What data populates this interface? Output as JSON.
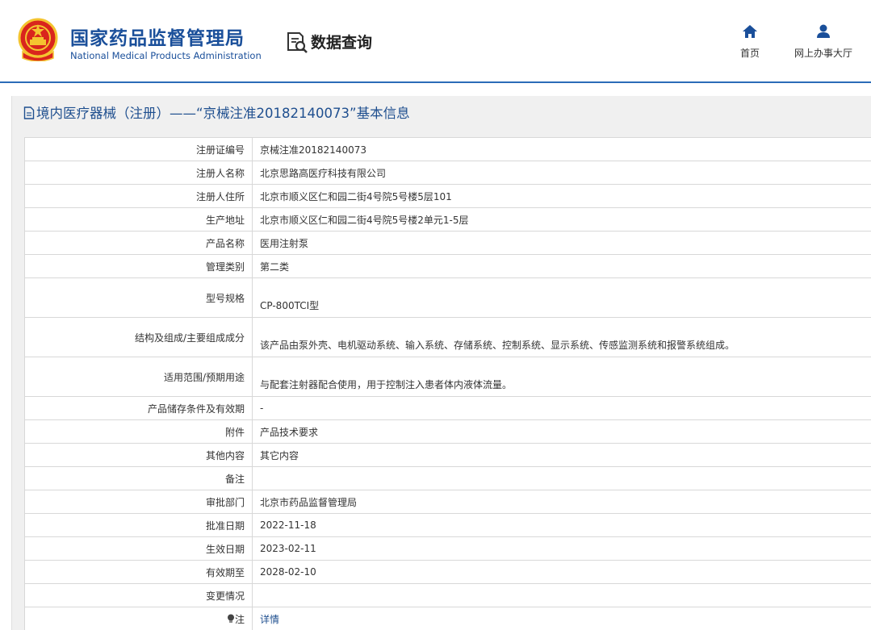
{
  "header": {
    "brand_cn": "国家药品监督管理局",
    "brand_en": "National Medical Products Administration",
    "data_query": "数据查询",
    "nav": {
      "home": "首页",
      "hall": "网上办事大厅"
    },
    "colors": {
      "brand": "#1a4f9a",
      "accent": "#2b6cb8",
      "emblem_red": "#d9251d",
      "emblem_gold": "#f4c430"
    }
  },
  "panel": {
    "title": "境内医疗器械（注册）——“京械注准20182140073”基本信息",
    "title_icon": "document-icon"
  },
  "rows": [
    {
      "label": "注册证编号",
      "value": "京械注准20182140073"
    },
    {
      "label": "注册人名称",
      "value": "北京思路高医疗科技有限公司"
    },
    {
      "label": "注册人住所",
      "value": "北京市顺义区仁和园二街4号院5号楼5层101"
    },
    {
      "label": "生产地址",
      "value": "北京市顺义区仁和园二街4号院5号楼2单元1-5层"
    },
    {
      "label": "产品名称",
      "value": "医用注射泵"
    },
    {
      "label": "管理类别",
      "value": "第二类"
    },
    {
      "label": "型号规格",
      "value": "CP-800TCI型"
    },
    {
      "label": "结构及组成/主要组成成分",
      "value": "该产品由泵外壳、电机驱动系统、输入系统、存储系统、控制系统、显示系统、传感监测系统和报警系统组成。"
    },
    {
      "label": "适用范围/预期用途",
      "value": "与配套注射器配合使用，用于控制注入患者体内液体流量。"
    },
    {
      "label": "产品储存条件及有效期",
      "value": "-"
    },
    {
      "label": "附件",
      "value": "产品技术要求"
    },
    {
      "label": "其他内容",
      "value": "其它内容"
    },
    {
      "label": "备注",
      "value": ""
    },
    {
      "label": "审批部门",
      "value": "北京市药品监督管理局"
    },
    {
      "label": "批准日期",
      "value": "2022-11-18"
    },
    {
      "label": "生效日期",
      "value": "2023-02-11"
    },
    {
      "label": "有效期至",
      "value": "2028-02-10"
    },
    {
      "label": "变更情况",
      "value": ""
    }
  ],
  "note_row": {
    "label": "注",
    "label_icon": "bulb-icon",
    "value": "详情"
  }
}
